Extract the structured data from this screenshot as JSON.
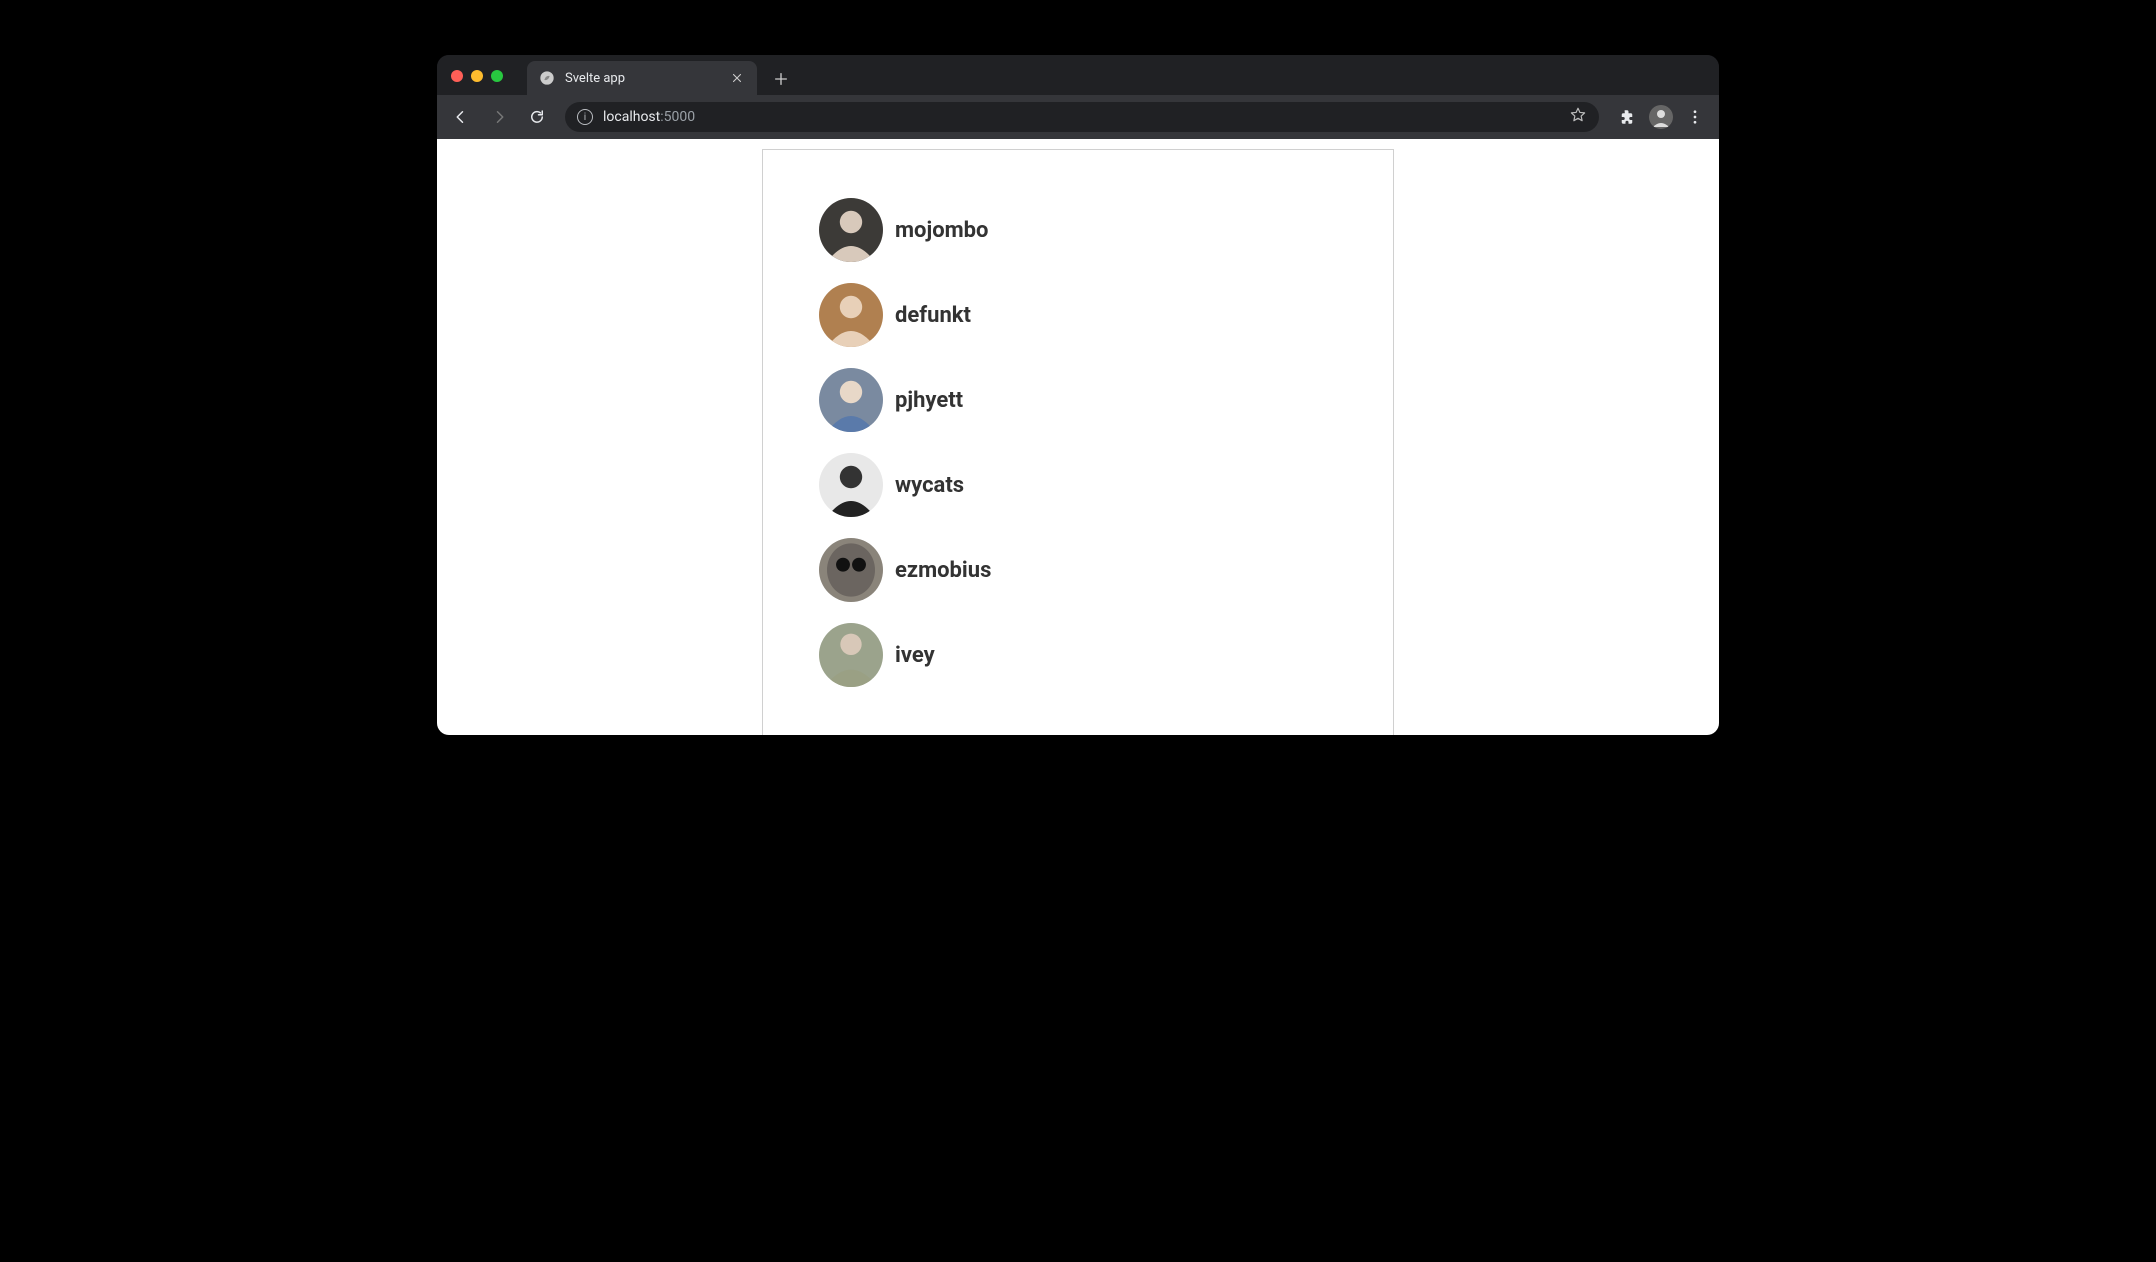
{
  "browser": {
    "tab_title": "Svelte app",
    "url_host": "localhost",
    "url_port": ":5000"
  },
  "users": [
    {
      "name": "mojombo",
      "avatar_bg": "#3c3a37"
    },
    {
      "name": "defunkt",
      "avatar_bg": "#b08050"
    },
    {
      "name": "pjhyett",
      "avatar_bg": "#7a8aa0"
    },
    {
      "name": "wycats",
      "avatar_bg": "#e8e8e8"
    },
    {
      "name": "ezmobius",
      "avatar_bg": "#8a847a"
    },
    {
      "name": "ivey",
      "avatar_bg": "#9ba38c"
    }
  ]
}
